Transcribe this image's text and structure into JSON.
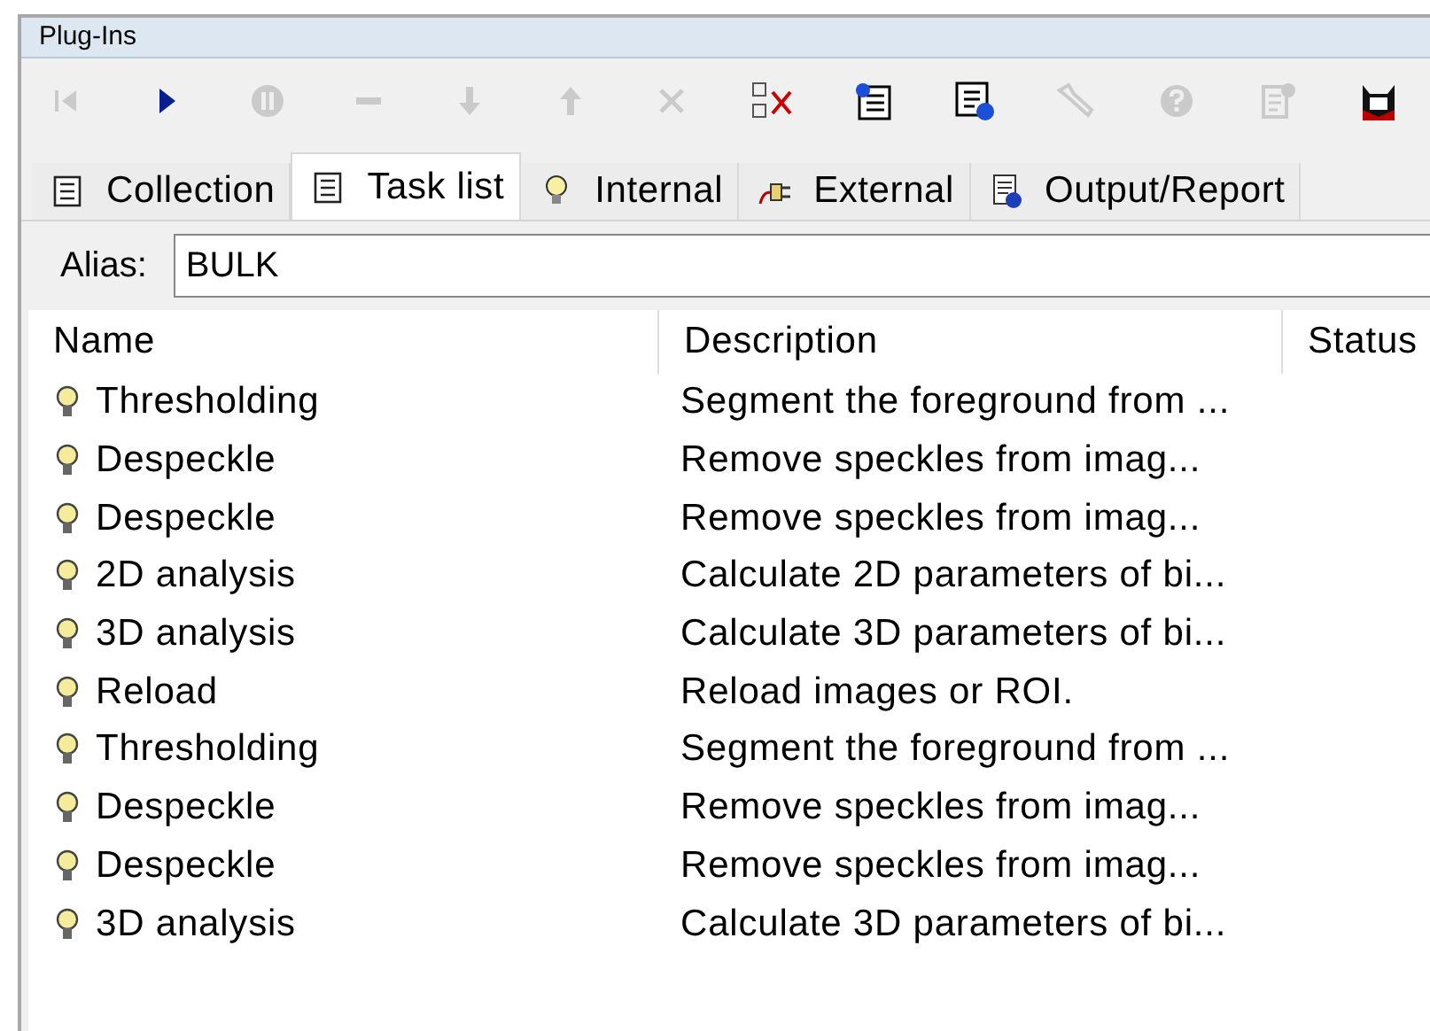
{
  "panel": {
    "title": "Plug-Ins"
  },
  "toolbar": [
    {
      "kind": "first",
      "disabled": true
    },
    {
      "kind": "play",
      "disabled": false
    },
    {
      "kind": "pause",
      "disabled": true
    },
    {
      "kind": "minus",
      "disabled": true
    },
    {
      "kind": "down",
      "disabled": true
    },
    {
      "kind": "up",
      "disabled": true
    },
    {
      "kind": "cross",
      "disabled": true
    },
    {
      "kind": "clear",
      "disabled": false
    },
    {
      "kind": "listadd",
      "disabled": false
    },
    {
      "kind": "listgo",
      "disabled": false
    },
    {
      "kind": "wrench",
      "disabled": true
    },
    {
      "kind": "help",
      "disabled": true
    },
    {
      "kind": "docq",
      "disabled": true
    },
    {
      "kind": "mask",
      "disabled": false
    }
  ],
  "tabs": [
    {
      "label": "Collection",
      "kind": "collection",
      "selected": false
    },
    {
      "label": "Task list",
      "kind": "list",
      "selected": true
    },
    {
      "label": "Internal",
      "kind": "bulb",
      "selected": false
    },
    {
      "label": "External",
      "kind": "plug",
      "selected": false
    },
    {
      "label": "Output/Report",
      "kind": "report",
      "selected": false
    }
  ],
  "alias": {
    "label": "Alias:",
    "value": "BULK"
  },
  "table": {
    "columns": [
      "Name",
      "Description",
      "Status"
    ],
    "rows": [
      {
        "name": "Thresholding",
        "description": "Segment the foreground from ..."
      },
      {
        "name": "Despeckle",
        "description": "Remove speckles from imag..."
      },
      {
        "name": "Despeckle",
        "description": "Remove speckles from imag..."
      },
      {
        "name": "2D analysis",
        "description": "Calculate 2D parameters of bi..."
      },
      {
        "name": "3D analysis",
        "description": "Calculate 3D parameters of bi..."
      },
      {
        "name": "Reload",
        "description": "Reload images or ROI."
      },
      {
        "name": "Thresholding",
        "description": "Segment the foreground from ..."
      },
      {
        "name": "Despeckle",
        "description": "Remove speckles from imag..."
      },
      {
        "name": "Despeckle",
        "description": "Remove speckles from imag..."
      },
      {
        "name": "3D analysis",
        "description": "Calculate 3D parameters of bi..."
      }
    ]
  }
}
